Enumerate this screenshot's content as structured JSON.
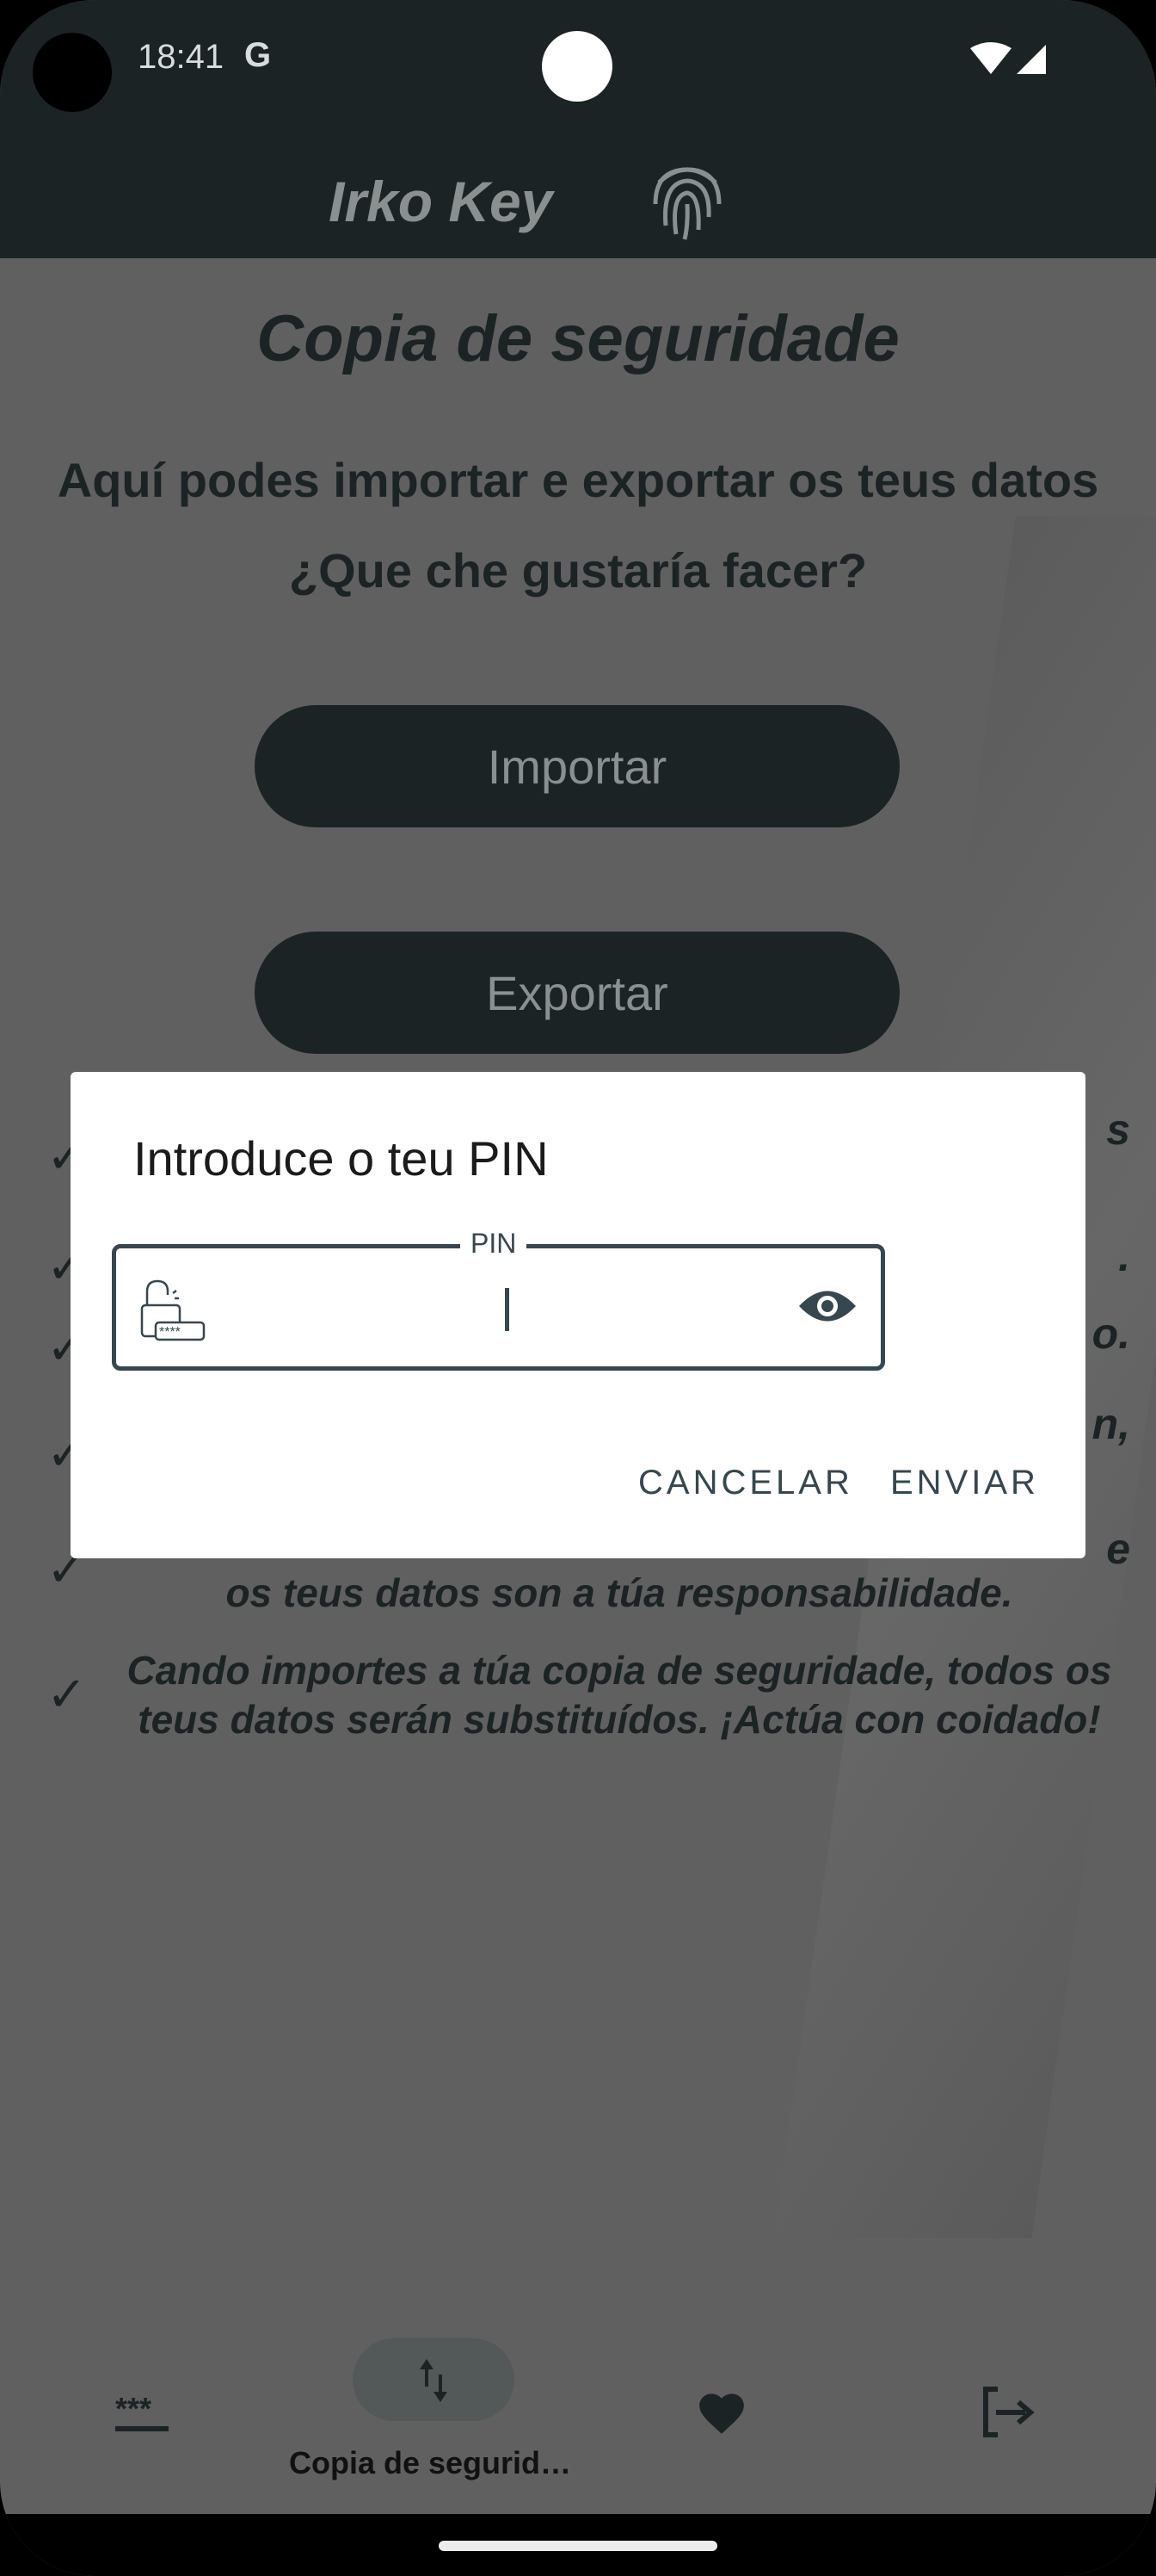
{
  "status_bar": {
    "time": "18:41",
    "g_icon": "G"
  },
  "header": {
    "app_title": "Irko Key",
    "logo_icon": "fingerprint-icon"
  },
  "main": {
    "title": "Copia de seguridade",
    "intro_line1": "Aquí podes importar e exportar os teus datos",
    "intro_line2": "¿Que che gustaría facer?",
    "import_label": "Importar",
    "export_label": "Exportar",
    "hidden_fragments": [
      "s",
      ".",
      "o.",
      "n,",
      "e"
    ],
    "notes": [
      {
        "line1": "os teus datos son a túa responsabilidade."
      },
      {
        "line1": "Cando importes a túa copia de seguridade, todos os",
        "line2": "teus datos serán substituídos. ¡Actúa con coidado!"
      }
    ]
  },
  "dialog": {
    "title": "Introduce o teu PIN",
    "pin_label": "PIN",
    "pin_value": "",
    "cancel_label": "CANCELAR",
    "send_label": "ENVIAR"
  },
  "bottom_nav": {
    "items": [
      {
        "icon": "password-icon",
        "label": ""
      },
      {
        "icon": "swap-vert-icon",
        "label": "Copia de segurid…",
        "active": true
      },
      {
        "icon": "heart-icon",
        "label": ""
      },
      {
        "icon": "logout-icon",
        "label": ""
      }
    ]
  }
}
